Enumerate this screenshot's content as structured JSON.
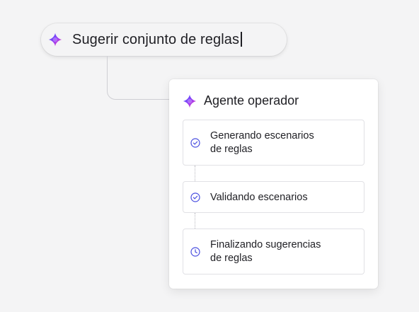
{
  "prompt": {
    "text": "Sugerir conjunto de reglas",
    "icon": "sparkle-logo-icon"
  },
  "agent_card": {
    "title": "Agente operador",
    "icon": "sparkle-logo-icon",
    "steps": [
      {
        "label_line1": "Generando escenarios",
        "label_line2": "de reglas",
        "status": "completed",
        "icon": "check-circle-icon"
      },
      {
        "label_line1": "Validando escenarios",
        "status": "completed",
        "icon": "check-circle-icon"
      },
      {
        "label_line1": "Finalizando sugerencias",
        "label_line2": "de reglas",
        "status": "in-progress",
        "icon": "clock-icon"
      }
    ]
  },
  "colors": {
    "background": "#f4f4f5",
    "card": "#ffffff",
    "status_icon": "#4a4fe0",
    "logo_gradient": [
      "#3b5bff",
      "#9b3bf5",
      "#ff4fa3"
    ]
  }
}
